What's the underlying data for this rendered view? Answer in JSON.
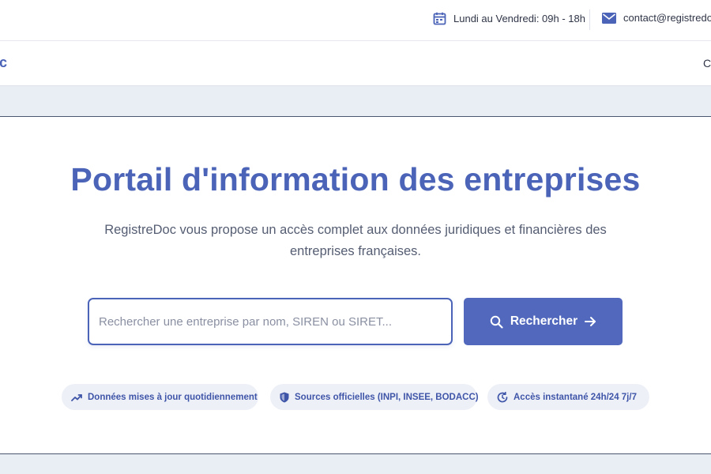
{
  "topbar": {
    "hours_icon": "calendar-icon",
    "hours_text": "Lundi au Vendredi: 09h - 18h",
    "mail_icon": "envelope-icon",
    "mail_text": "contact@registredoc"
  },
  "navbar": {
    "logo_tail": "c",
    "nav_tail": "C"
  },
  "hero": {
    "title": "Portail d'information des entreprises",
    "subtitle": "RegistreDoc vous propose un accès complet aux données juridiques et financières des entreprises françaises."
  },
  "search": {
    "placeholder": "Rechercher une entreprise par nom, SIREN ou SIRET...",
    "value": "",
    "button_label": "Rechercher",
    "button_icon": "search-icon",
    "button_arrow_icon": "arrow-right-icon"
  },
  "features": [
    {
      "icon": "trending-up-icon",
      "label": "Données mises à jour quotidiennement"
    },
    {
      "icon": "shield-icon",
      "label": "Sources officielles (INPI, INSEE, BODACC)"
    },
    {
      "icon": "refresh-clock-icon",
      "label": "Accès instantané 24h/24 7j/7"
    }
  ],
  "colors": {
    "brand": "#4b64b8",
    "button": "#5168bd",
    "band": "#e9edf4",
    "pill_bg": "#eef0f8"
  }
}
